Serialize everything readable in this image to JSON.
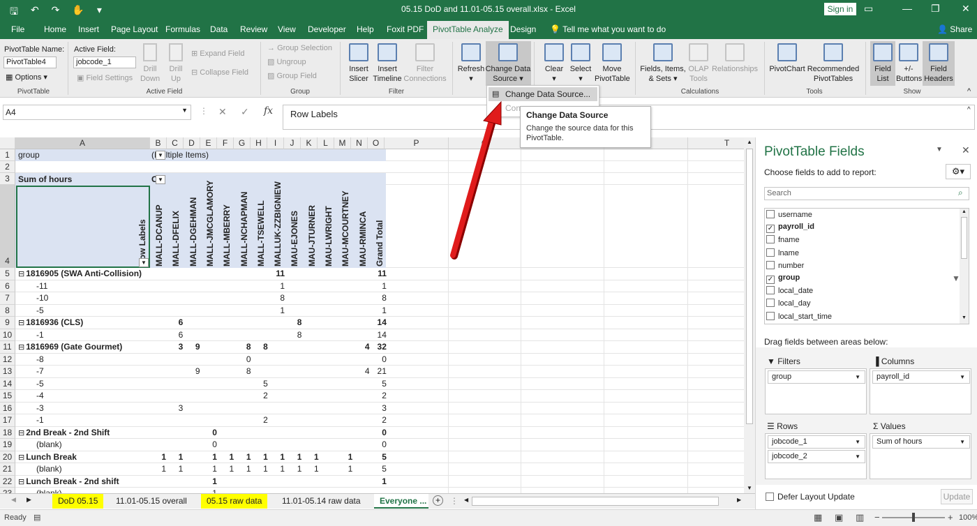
{
  "titlebar": {
    "title": "05.15 DoD and 11.01-05.15 overall.xlsx  -  Excel",
    "sign_in": "Sign in",
    "save_icon": "save-icon",
    "minimize": "—",
    "restore": "❐",
    "close": "✕"
  },
  "tabs": [
    "File",
    "Home",
    "Insert",
    "Page Layout",
    "Formulas",
    "Data",
    "Review",
    "View",
    "Developer",
    "Help",
    "Foxit PDF",
    "PivotTable Analyze",
    "Design"
  ],
  "tell_me": "Tell me what you want to do",
  "share": "Share",
  "ribbon": {
    "pt_name_label": "PivotTable Name:",
    "pt_name": "PivotTable4",
    "options": "Options",
    "group_pivottable": "PivotTable",
    "active_field_label": "Active Field:",
    "active_field": "jobcode_1",
    "field_settings": "Field Settings",
    "drill_down": "Drill Down",
    "drill_up": "Drill Up",
    "expand_field": "Expand Field",
    "collapse_field": "Collapse Field",
    "group_active_field": "Active Field",
    "group_selection": "Group Selection",
    "ungroup": "Ungroup",
    "group_field": "Group Field",
    "group_group": "Group",
    "insert_slicer": "Insert Slicer",
    "insert_timeline": "Insert Timeline",
    "filter_connections": "Filter Connections",
    "group_filter": "Filter",
    "refresh": "Refresh",
    "change_data_source": "Change Data Source",
    "group_data": "Data",
    "clear": "Clear",
    "select": "Select",
    "move_pivottable": "Move PivotTable",
    "group_actions": "Actions",
    "fields_items_sets": "Fields, Items, & Sets",
    "olap_tools": "OLAP Tools",
    "relationships": "Relationships",
    "group_calculations": "Calculations",
    "pivotchart": "PivotChart",
    "recommended_pivottables": "Recommended PivotTables",
    "group_tools": "Tools",
    "field_list": "Field List",
    "plus_minus_buttons": "+/- Buttons",
    "field_headers": "Field Headers",
    "group_show": "Show"
  },
  "dropdown": {
    "item1": "Change Data Source...",
    "item2": "Con"
  },
  "tooltip": {
    "title": "Change Data Source",
    "body": "Change the source data for this PivotTable."
  },
  "formula_bar": {
    "name_box": "A4",
    "cancel": "✕",
    "enter": "✓",
    "fx": "fx",
    "content": "Row Labels"
  },
  "grid": {
    "columns": [
      "A",
      "B",
      "C",
      "D",
      "E",
      "F",
      "G",
      "H",
      "I",
      "J",
      "K",
      "L",
      "M",
      "N",
      "O",
      "P",
      "Q",
      "R",
      "S",
      "T"
    ],
    "rows": [
      "1",
      "2",
      "3",
      "4",
      "5",
      "6",
      "7",
      "8",
      "9",
      "10",
      "11",
      "12",
      "13",
      "14",
      "15",
      "16",
      "17",
      "18",
      "19",
      "20",
      "21",
      "22",
      "23"
    ],
    "a1": "group",
    "b1": "(Multiple Items)",
    "a3": "Sum of hours",
    "b3": "C",
    "row_labels": "Row Labels",
    "col_names": [
      "MALL-DCANUP",
      "MALL-DFELIX",
      "MALL-DGEHMAN",
      "MALL-JMCGLAMORY",
      "MALL-MBERRY",
      "MALL-NCHAPMAN",
      "MALL-TSEWELL",
      "MALLUK-ZZBIGNIEW",
      "MAU-EJONES",
      "MAU-JTURNER",
      "MAU-LWRIGHT",
      "MAU-MCOURTNEY",
      "MAU-RMINCA",
      "Grand Total"
    ],
    "data_rows": [
      {
        "label": "1816905 (SWA Anti-Collision)",
        "bold": true,
        "indent": 0,
        "collapse": true,
        "vals": [
          "",
          "",
          "",
          "",
          "",
          "",
          "",
          "11",
          "",
          "",
          "",
          "",
          "",
          "11"
        ]
      },
      {
        "label": "-11",
        "bold": false,
        "indent": 2,
        "vals": [
          "",
          "",
          "",
          "",
          "",
          "",
          "",
          "1",
          "",
          "",
          "",
          "",
          "",
          "1"
        ]
      },
      {
        "label": "-10",
        "bold": false,
        "indent": 2,
        "vals": [
          "",
          "",
          "",
          "",
          "",
          "",
          "",
          "8",
          "",
          "",
          "",
          "",
          "",
          "8"
        ]
      },
      {
        "label": "-5",
        "bold": false,
        "indent": 2,
        "vals": [
          "",
          "",
          "",
          "",
          "",
          "",
          "",
          "1",
          "",
          "",
          "",
          "",
          "",
          "1"
        ]
      },
      {
        "label": "1816936 (CLS)",
        "bold": true,
        "indent": 0,
        "collapse": true,
        "vals": [
          "",
          "6",
          "",
          "",
          "",
          "",
          "",
          "",
          "8",
          "",
          "",
          "",
          "",
          "14"
        ]
      },
      {
        "label": "-1",
        "bold": false,
        "indent": 2,
        "vals": [
          "",
          "6",
          "",
          "",
          "",
          "",
          "",
          "",
          "8",
          "",
          "",
          "",
          "",
          "14"
        ]
      },
      {
        "label": "1816969 (Gate Gourmet)",
        "bold": true,
        "indent": 0,
        "collapse": true,
        "vals": [
          "",
          "3",
          "9",
          "",
          "",
          "8",
          "8",
          "",
          "",
          "",
          "",
          "",
          "4",
          "32"
        ]
      },
      {
        "label": "-8",
        "bold": false,
        "indent": 2,
        "vals": [
          "",
          "",
          "",
          "",
          "",
          "0",
          "",
          "",
          "",
          "",
          "",
          "",
          "",
          "0"
        ]
      },
      {
        "label": "-7",
        "bold": false,
        "indent": 2,
        "vals": [
          "",
          "",
          "9",
          "",
          "",
          "8",
          "",
          "",
          "",
          "",
          "",
          "",
          "4",
          "21"
        ]
      },
      {
        "label": "-5",
        "bold": false,
        "indent": 2,
        "vals": [
          "",
          "",
          "",
          "",
          "",
          "",
          "5",
          "",
          "",
          "",
          "",
          "",
          "",
          "5"
        ]
      },
      {
        "label": "-4",
        "bold": false,
        "indent": 2,
        "vals": [
          "",
          "",
          "",
          "",
          "",
          "",
          "2",
          "",
          "",
          "",
          "",
          "",
          "",
          "2"
        ]
      },
      {
        "label": "-3",
        "bold": false,
        "indent": 2,
        "vals": [
          "",
          "3",
          "",
          "",
          "",
          "",
          "",
          "",
          "",
          "",
          "",
          "",
          "",
          "3"
        ]
      },
      {
        "label": "-1",
        "bold": false,
        "indent": 2,
        "vals": [
          "",
          "",
          "",
          "",
          "",
          "",
          "2",
          "",
          "",
          "",
          "",
          "",
          "",
          "2"
        ]
      },
      {
        "label": "2nd Break - 2nd Shift",
        "bold": true,
        "indent": 0,
        "collapse": true,
        "vals": [
          "",
          "",
          "",
          "0",
          "",
          "",
          "",
          "",
          "",
          "",
          "",
          "",
          "",
          "0"
        ]
      },
      {
        "label": "(blank)",
        "bold": false,
        "indent": 2,
        "vals": [
          "",
          "",
          "",
          "0",
          "",
          "",
          "",
          "",
          "",
          "",
          "",
          "",
          "",
          "0"
        ]
      },
      {
        "label": "Lunch Break",
        "bold": true,
        "indent": 0,
        "collapse": true,
        "vals": [
          "1",
          "1",
          "",
          "1",
          "1",
          "1",
          "1",
          "1",
          "1",
          "1",
          "",
          "1",
          "",
          "5"
        ]
      },
      {
        "label": "(blank)",
        "bold": false,
        "indent": 2,
        "vals": [
          "1",
          "1",
          "",
          "1",
          "1",
          "1",
          "1",
          "1",
          "1",
          "1",
          "",
          "1",
          "",
          "5"
        ]
      },
      {
        "label": "Lunch Break - 2nd shift",
        "bold": true,
        "indent": 0,
        "collapse": true,
        "vals": [
          "",
          "",
          "",
          "1",
          "",
          "",
          "",
          "",
          "",
          "",
          "",
          "",
          "",
          "1"
        ]
      },
      {
        "label": "(blank)",
        "bold": false,
        "indent": 2,
        "vals": [
          "",
          "",
          "",
          "1",
          "",
          "",
          "",
          "",
          "",
          "",
          "",
          "",
          "",
          ""
        ]
      }
    ]
  },
  "sheet_tabs": [
    "DoD 05.15",
    "11.01-05.15 overall",
    "05.15 raw data",
    "11.01-05.14 raw data",
    "Everyone ..."
  ],
  "status": {
    "ready": "Ready",
    "zoom": "100%",
    "minus": "−",
    "plus": "+"
  },
  "pane": {
    "title": "PivotTable Fields",
    "subtitle": "Choose fields to add to report:",
    "search_placeholder": "Search",
    "fields": [
      {
        "name": "username",
        "checked": false,
        "bold": false
      },
      {
        "name": "payroll_id",
        "checked": true,
        "bold": true
      },
      {
        "name": "fname",
        "checked": false,
        "bold": false
      },
      {
        "name": "lname",
        "checked": false,
        "bold": false
      },
      {
        "name": "number",
        "checked": false,
        "bold": false
      },
      {
        "name": "group",
        "checked": true,
        "bold": true
      },
      {
        "name": "local_date",
        "checked": false,
        "bold": false
      },
      {
        "name": "local_day",
        "checked": false,
        "bold": false
      },
      {
        "name": "local_start_time",
        "checked": false,
        "bold": false
      }
    ],
    "drag_label": "Drag fields between areas below:",
    "filters_label": "Filters",
    "columns_label": "Columns",
    "rows_label": "Rows",
    "values_label": "Values",
    "filters": [
      "group"
    ],
    "columns": [
      "payroll_id"
    ],
    "rows": [
      "jobcode_1",
      "jobcode_2"
    ],
    "values": [
      "Sum of hours"
    ],
    "defer": "Defer Layout Update",
    "update": "Update"
  },
  "colors": {
    "excel_green": "#217346",
    "arrow_red": "#e01b1b",
    "pivot_blue": "#dbe3f2",
    "yellow_tab": "#ffff00"
  }
}
